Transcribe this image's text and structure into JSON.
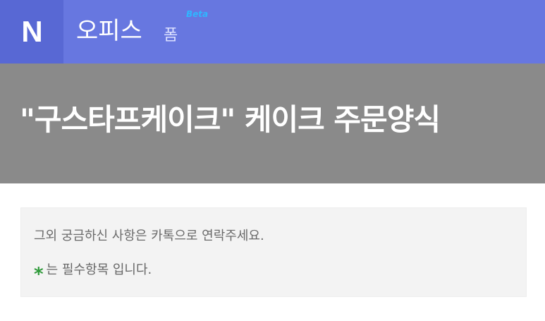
{
  "header": {
    "logo_letter": "N",
    "app_name": "오피스",
    "app_sub": "폼",
    "badge": "Beta",
    "colors": {
      "bar": "#6777e0",
      "logo_bg": "#5868d4",
      "badge": "#2fb6ff"
    }
  },
  "hero": {
    "title": "\"구스타프케이크\" 케이크 주문양식",
    "background": "#8a8a8a"
  },
  "notice": {
    "line1": "그외 궁금하신 사항은 카톡으로 연락주세요.",
    "required_mark": "*",
    "required_text": "는 필수항목 입니다.",
    "required_color": "#2f9a3a"
  }
}
